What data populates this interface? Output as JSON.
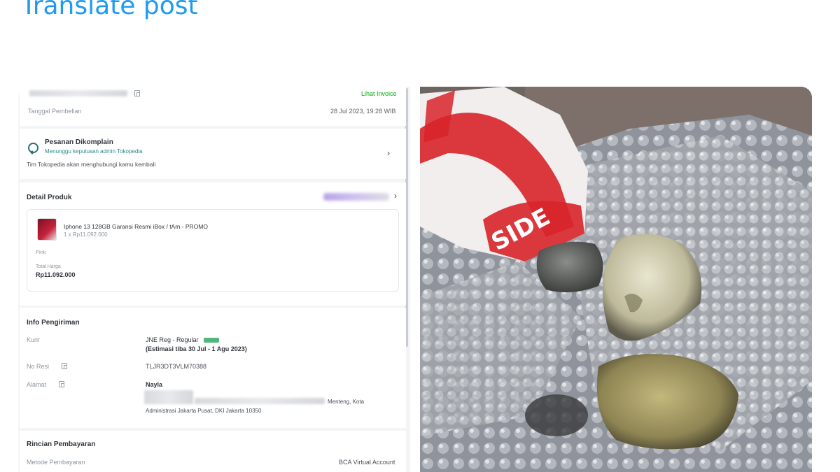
{
  "post": {
    "translate_label": "Translate post"
  },
  "order": {
    "invoice_link": "Lihat Invoice",
    "purchase_date_label": "Tanggal Pembelian",
    "purchase_date_value": "28 Jul 2023, 19:28 WIB",
    "complaint": {
      "title": "Pesanan Dikomplain",
      "subtitle": "Menunggu keputusan admin Tokopedia",
      "note": "Tim Tokopedia akan menghubungi kamu kembali"
    },
    "product_section": {
      "title": "Detail Produk",
      "product_name": "Iphone 13 128GB Garansi Resmi iBox / tAm - PROMO",
      "quantity_price": "1 x Rp11.092.000",
      "variant": "Pink",
      "total_label": "Total Harga",
      "total_value": "Rp11.092.000"
    },
    "shipping": {
      "title": "Info Pengiriman",
      "courier_label": "Kurir",
      "courier_value": "JNE Reg - Regular",
      "estimate": "(Estimasi tiba 30 Jul - 1 Agu 2023)",
      "receipt_label": "No Resi",
      "receipt_value": "TLJR3DT3VLM70388",
      "address_label": "Alamat",
      "recipient_name": "Nayla",
      "address_line1_tail": "Menteng, Kota",
      "address_line2": "Administrasi Jakarta Pusat, DKI Jakarta 10350"
    },
    "payment": {
      "title": "Rincian Pembayaran",
      "method_label": "Metode Pembayaran",
      "method_value": "BCA Virtual Account"
    }
  },
  "photo": {
    "package_tape_text": "SIDE",
    "tape_color": "#d8232a"
  },
  "colors": {
    "link_blue": "#1d9bf0",
    "tokopedia_green": "#03ac0e"
  }
}
